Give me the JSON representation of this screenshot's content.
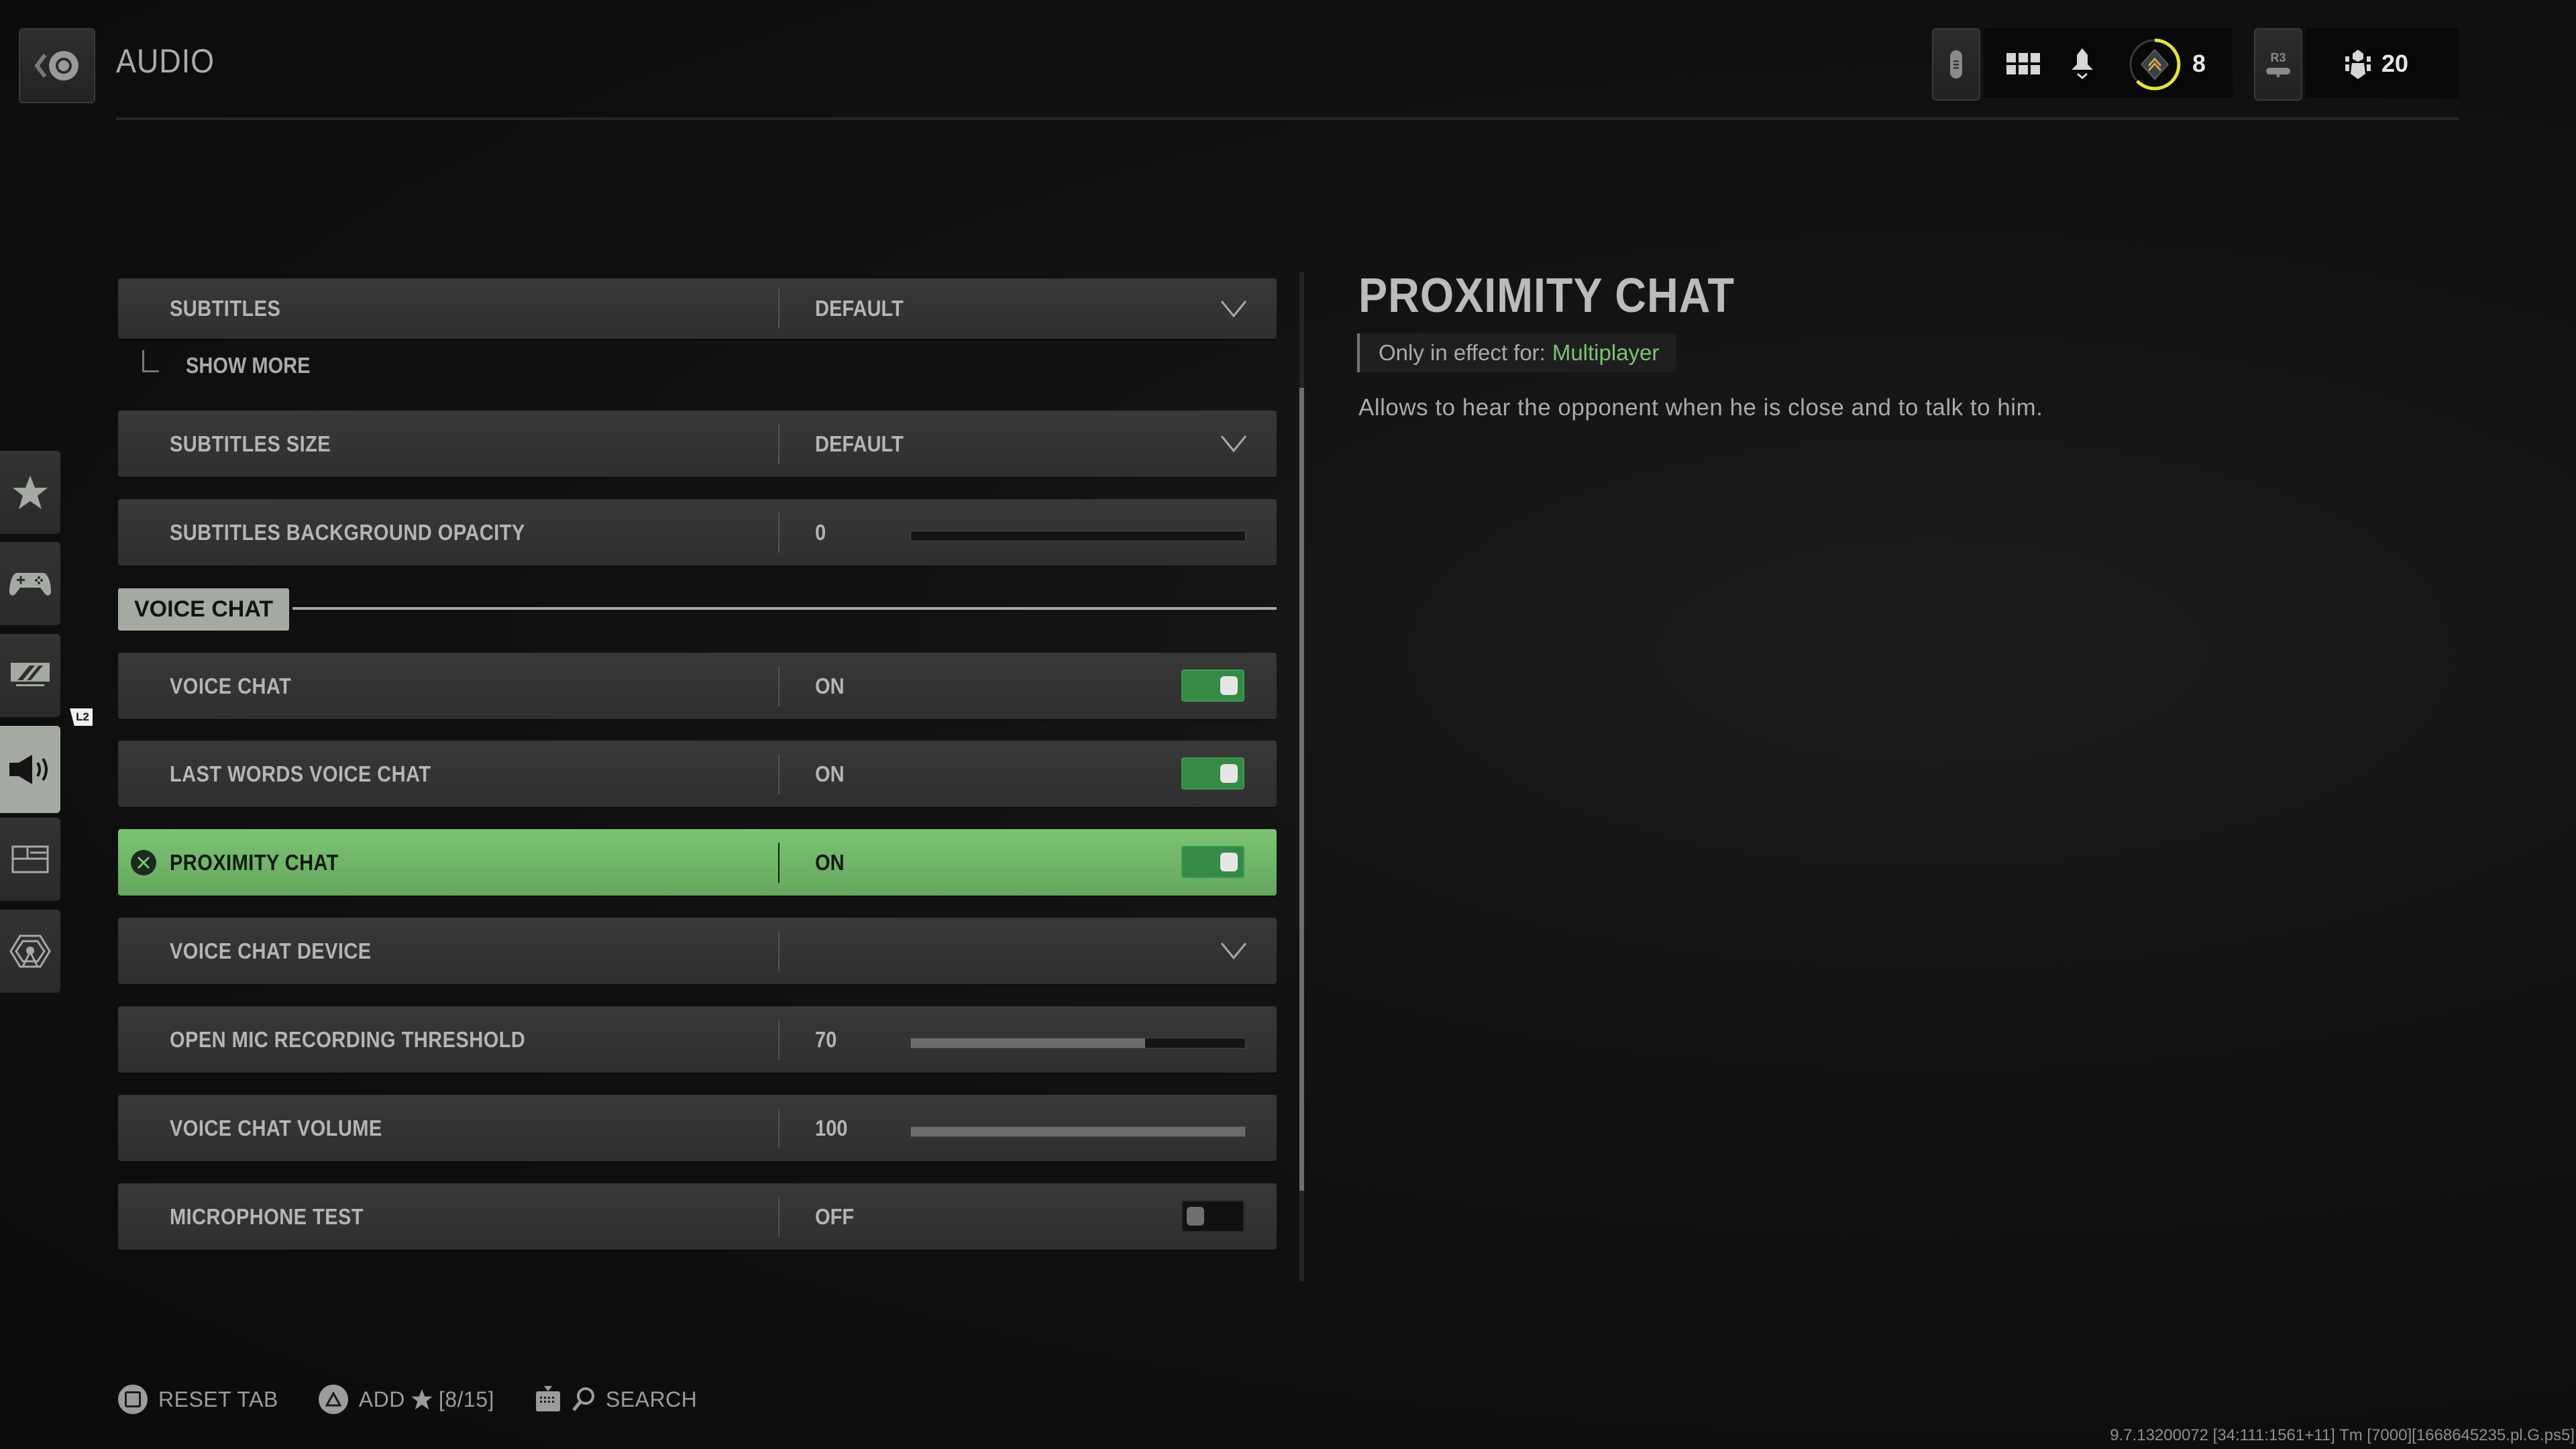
{
  "header": {
    "title": "AUDIO",
    "back_button": "back-button",
    "icons": [
      "controller-menu-icon",
      "grid-icon",
      "bell-icon",
      "rank-icon",
      "r3-button-icon",
      "social-icon"
    ],
    "rank_value": "8",
    "rank_progress_fraction": 0.55,
    "r3_label": "R3",
    "friends_count": "20"
  },
  "sidebar": {
    "items": [
      {
        "name": "favorites",
        "icon": "star-icon",
        "active": false
      },
      {
        "name": "controller",
        "icon": "gamepad-icon",
        "active": false
      },
      {
        "name": "graphics",
        "icon": "display-icon",
        "active": false
      },
      {
        "name": "audio",
        "icon": "speaker-icon",
        "active": true
      },
      {
        "name": "interface",
        "icon": "interface-icon",
        "active": false
      },
      {
        "name": "account-network",
        "icon": "network-icon",
        "active": false
      }
    ],
    "l2_badge": "L2"
  },
  "settings": {
    "subtitles": {
      "label": "SUBTITLES",
      "value": "DEFAULT"
    },
    "show_more": "SHOW MORE",
    "subtitles_size": {
      "label": "SUBTITLES SIZE",
      "value": "DEFAULT"
    },
    "subtitles_bg_opacity": {
      "label": "SUBTITLES BACKGROUND OPACITY",
      "value": "0",
      "fraction": 0
    },
    "section_voice_chat": "VOICE CHAT",
    "voice_chat": {
      "label": "VOICE CHAT",
      "value": "ON"
    },
    "last_words": {
      "label": "LAST WORDS VOICE CHAT",
      "value": "ON"
    },
    "proximity_chat": {
      "label": "PROXIMITY CHAT",
      "value": "ON",
      "selected": true
    },
    "voice_chat_device": {
      "label": "VOICE CHAT DEVICE",
      "value": ""
    },
    "open_mic_threshold": {
      "label": "OPEN MIC RECORDING THRESHOLD",
      "value": "70",
      "fraction": 0.7
    },
    "voice_chat_volume": {
      "label": "VOICE CHAT VOLUME",
      "value": "100",
      "fraction": 1.0
    },
    "microphone_test": {
      "label": "MICROPHONE TEST",
      "value": "OFF"
    }
  },
  "scroll": {
    "thumb_start_fraction": 0.115,
    "thumb_size_fraction": 0.795
  },
  "description": {
    "title": "PROXIMITY CHAT",
    "tag_prefix": "Only in effect for:",
    "tag_mode": "Multiplayer",
    "text": "Allows to hear the opponent when he is close and to talk to him."
  },
  "footer": {
    "reset_tab": "RESET TAB",
    "add_favorite": "ADD",
    "favorite_count": "[8/15]",
    "search": "SEARCH"
  },
  "build_info": "9.7.13200072 [34:111:1561+11] Tm [7000][1668645235.pl.G.ps5]",
  "colors": {
    "accent_green": "#7cc474",
    "toggle_on": "#358a45",
    "rank_ring": "#e3e339",
    "chip_gray": "#a5aaa3"
  }
}
